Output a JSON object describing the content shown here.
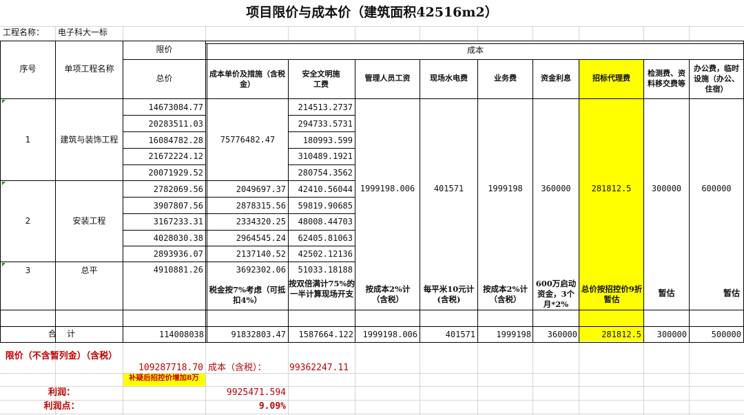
{
  "title": "项目限价与成本价（建筑面积42516m2）",
  "project": {
    "label": "工程名称：",
    "value": "电子科大一标"
  },
  "headers": {
    "seq": "序号",
    "item_name": "单项工程名称",
    "limit": "限价",
    "total": "总价",
    "cost": "成本",
    "cost_unit": "成本单价及措施（含税金）",
    "safety": "安全文明施工费",
    "mgmt": "管理人员工资",
    "utility": "现场水电费",
    "business": "业务费",
    "interest": "资金利息",
    "agent": "招标代理费",
    "testing": "检测费、资料移交费等",
    "office": "办公费，临时设施（办公、住宿）"
  },
  "groups": [
    {
      "seq": "1",
      "name": "建筑与装饰工程",
      "cost_unit": "75776482.47"
    },
    {
      "seq": "2",
      "name": "安装工程"
    },
    {
      "seq": "3",
      "name": "总平"
    }
  ],
  "totals": [
    "14673084.77",
    "20283511.03",
    "16084782.28",
    "21672224.12",
    "20071929.52",
    "2782069.56",
    "3907807.56",
    "3167233.31",
    "4028030.38",
    "2893936.07",
    "4910881.26"
  ],
  "cost_units": [
    "2049697.37",
    "2878315.56",
    "2334320.25",
    "2964545.24",
    "2137140.52",
    "3692302.06"
  ],
  "safety_fees": [
    "214513.2737",
    "294733.5731",
    "180993.599",
    "310489.1921",
    "280754.3562",
    "42410.56044",
    "59819.90685",
    "48008.44703",
    "62405.81063",
    "42502.12136",
    "51033.18188"
  ],
  "merged_values": {
    "mgmt": "1999198.006",
    "utility": "401571",
    "business": "1999198",
    "interest": "360000",
    "agent": "281812.5",
    "testing": "300000",
    "office": "600000"
  },
  "notes": {
    "cost_unit": "税金按7%考虑（可抵扣4%）",
    "safety": "按双倍满计75%的一半计算现场开支",
    "mgmt": "按成本2%计（含税）",
    "utility": "每平米10元计(含税)",
    "business": "按成本2%计（含税）",
    "interest": "600万启动资金，3个月*2%",
    "agent": "总价按招控价9折暂估",
    "testing": "暂估",
    "office": "暂估"
  },
  "sum_row": {
    "label": "合    计",
    "total": "114008038",
    "cost_unit": "91832803.47",
    "safety": "1587664.122",
    "mgmt": "1999198.006",
    "utility": "401571",
    "business": "1999198",
    "interest": "360000",
    "agent": "281812.5",
    "testing": "300000",
    "office": "500000"
  },
  "summary": {
    "limit_label": "限价（不含暂列金）（含税）",
    "limit_value": "109287718.70",
    "cost_label": "成本（含税）：",
    "cost_value": "99362247.11",
    "note": "补疑后招控价增加8万",
    "profit_label": "利润：",
    "profit_value": "9925471.594",
    "profit_rate_label": "利润点：",
    "profit_rate_value": "9.09%"
  },
  "colors": {
    "highlight": "#ffff00",
    "red": "#c00000",
    "grid": "#d4d4d4"
  }
}
